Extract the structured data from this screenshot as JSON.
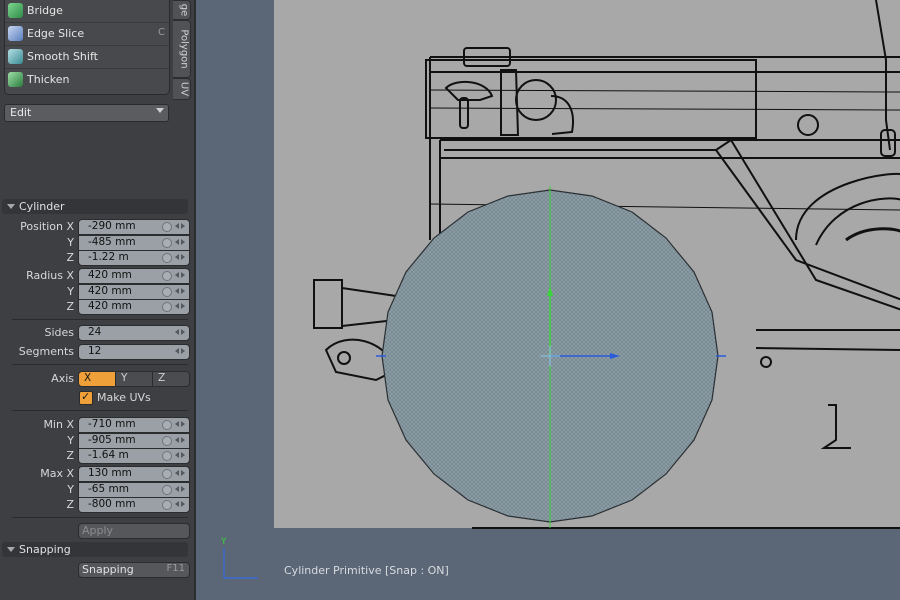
{
  "tools": [
    {
      "label": "Bridge",
      "hotkey": "",
      "icon": "bridge-icon",
      "color": "#3aa35a"
    },
    {
      "label": "Edge Slice",
      "hotkey": "C",
      "icon": "edge-slice-icon",
      "color": "#6a8fd0"
    },
    {
      "label": "Smooth Shift",
      "hotkey": "",
      "icon": "smooth-shift-icon",
      "color": "#4aa0a8"
    },
    {
      "label": "Thicken",
      "hotkey": "",
      "icon": "thicken-icon",
      "color": "#3aa35a"
    }
  ],
  "side_tabs": [
    "ge",
    "Polygon",
    "UV"
  ],
  "edit_dropdown": {
    "value": "Edit"
  },
  "cylinder": {
    "title": "Cylinder",
    "position": {
      "x_label": "Position X",
      "y_label": "Y",
      "z_label": "Z",
      "x": "-290 mm",
      "y": "-485 mm",
      "z": "-1.22 m"
    },
    "radius": {
      "x_label": "Radius X",
      "y_label": "Y",
      "z_label": "Z",
      "x": "420 mm",
      "y": "420 mm",
      "z": "420 mm"
    },
    "sides": {
      "label": "Sides",
      "value": "24"
    },
    "segments": {
      "label": "Segments",
      "value": "12"
    },
    "axis": {
      "label": "Axis",
      "options": [
        "X",
        "Y",
        "Z"
      ],
      "selected": "X"
    },
    "make_uvs": {
      "label": "Make UVs",
      "checked": true
    },
    "min": {
      "x_label": "Min X",
      "y_label": "Y",
      "z_label": "Z",
      "x": "-710 mm",
      "y": "-905 mm",
      "z": "-1.64 m"
    },
    "max": {
      "x_label": "Max X",
      "y_label": "Y",
      "z_label": "Z",
      "x": "130 mm",
      "y": "-65 mm",
      "z": "-800 mm"
    },
    "apply_label": "Apply"
  },
  "snapping": {
    "title": "Snapping",
    "button_label": "Snapping",
    "hotkey": "F11"
  },
  "viewport": {
    "status": "Cylinder Primitive  [Snap : ON]",
    "gizmo_label": "Y",
    "background_color": "#5b6676",
    "blueprint_color": "#a8a8a8",
    "cylinder_color": "#8a9ba3"
  }
}
